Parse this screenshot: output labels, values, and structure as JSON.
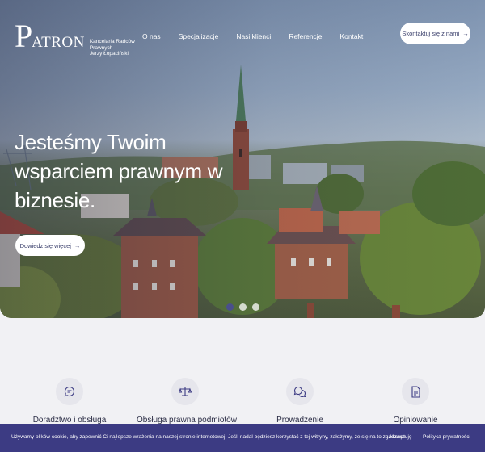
{
  "header": {
    "logo_letter": "P",
    "logo_word": "ATRON",
    "logo_sub_line1": "Kancelaria Radców Prawnych",
    "logo_sub_line2": "Jerzy Łopaciński",
    "nav": [
      "O nas",
      "Specjalizacje",
      "Nasi klienci",
      "Referencje",
      "Kontakt"
    ],
    "contact_label": "Skontaktuj się z nami",
    "arrow": "→"
  },
  "hero": {
    "title": "Jesteśmy Twoim wsparciem prawnym w biznesie.",
    "cta_label": "Dowiedz się więcej",
    "arrow": "→",
    "slides_total": 3,
    "active_slide": 1
  },
  "services": [
    {
      "title": "Doradztwo i obsługa",
      "icon": "chat-icon"
    },
    {
      "title": "Obsługa prawna podmiotów",
      "icon": "scales-icon"
    },
    {
      "title": "Prowadzenie",
      "icon": "conversation-icon"
    },
    {
      "title": "Opiniowanie",
      "icon": "document-icon"
    }
  ],
  "cookie": {
    "message": "Używamy plików cookie, aby zapewnić Ci najlepsze wrażenia na naszej stronie internetowej. Jeśli nadal będziesz korzystać z tej witryny, założymy, że się na to zgadzasz.",
    "accept_label": "Akceptuję",
    "policy_label": "Polityka prywatności"
  },
  "colors": {
    "accent": "#3c3b83",
    "button_text": "#3a3f6b",
    "page_bg": "#f1f1f4"
  }
}
